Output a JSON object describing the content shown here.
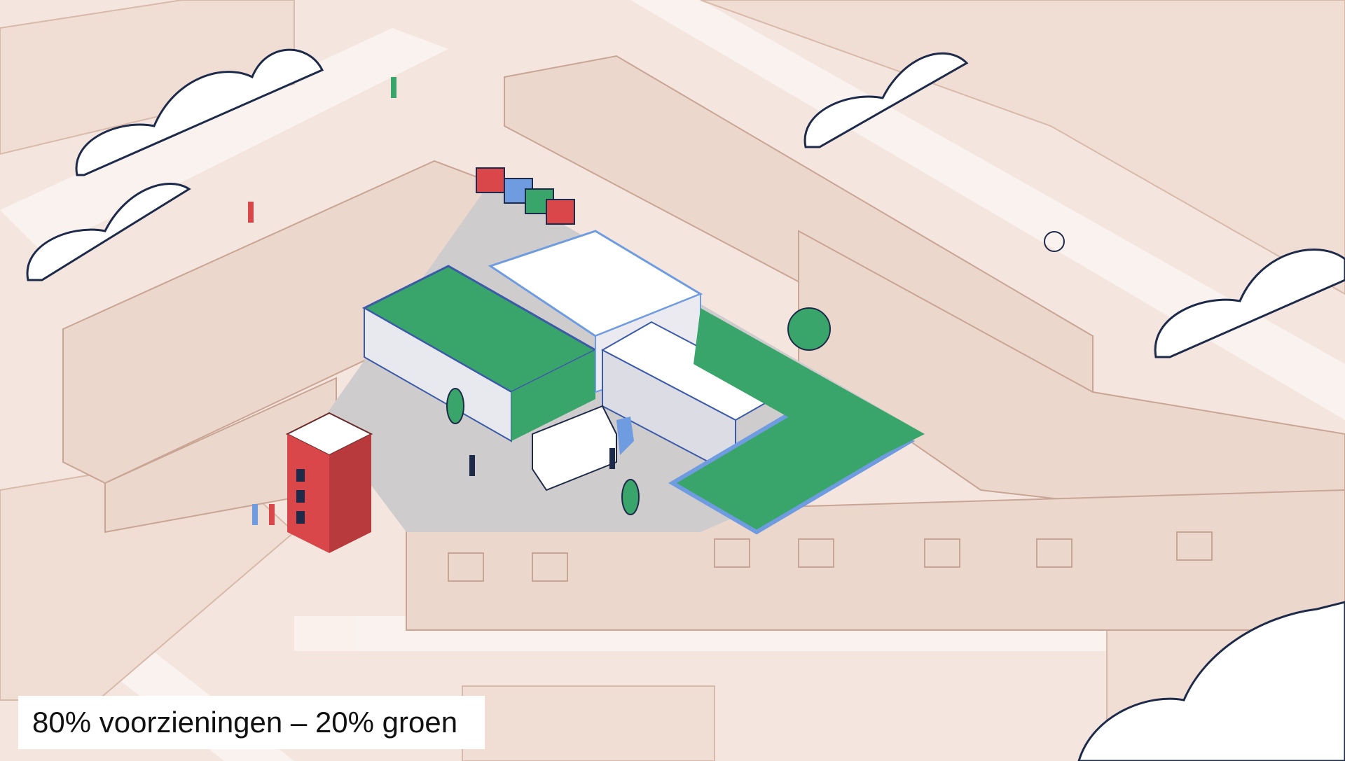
{
  "caption": {
    "text": "80% voorzieningen – 20% groen"
  },
  "colors": {
    "background": "#f4e6df",
    "building_fill": "#ecd7cc",
    "building_line": "#c9a595",
    "roof_green": "#3aa56a",
    "roof_edge": "#6f9be0",
    "tower_red": "#d9474a",
    "asphalt": "#cfcccd",
    "cloud_fill": "#ffffff",
    "cloud_line": "#1e2a4a"
  }
}
